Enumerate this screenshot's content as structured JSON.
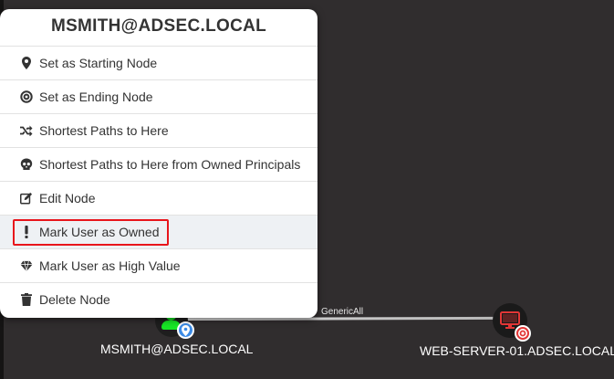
{
  "context_menu": {
    "title": "MSMITH@ADSEC.LOCAL",
    "items": [
      {
        "label": "Set as Starting Node",
        "icon": "map-marker-icon"
      },
      {
        "label": "Set as Ending Node",
        "icon": "target-icon"
      },
      {
        "label": "Shortest Paths to Here",
        "icon": "shuffle-icon"
      },
      {
        "label": "Shortest Paths to Here from Owned Principals",
        "icon": "skull-icon"
      },
      {
        "label": "Edit Node",
        "icon": "edit-icon"
      },
      {
        "label": "Mark User as Owned",
        "icon": "exclamation-icon",
        "highlighted": true
      },
      {
        "label": "Mark User as High Value",
        "icon": "gem-icon"
      },
      {
        "label": "Delete Node",
        "icon": "trash-icon"
      }
    ]
  },
  "graph": {
    "edge_label": "GenericAll",
    "source_node": {
      "label": "MSMITH@ADSEC.LOCAL",
      "type": "user",
      "color": "#17e625"
    },
    "target_node": {
      "label": "WEB-SERVER-01.ADSEC.LOCAL",
      "type": "computer",
      "color": "#e23636"
    }
  },
  "colors": {
    "background": "#302d2e",
    "highlight_outline": "#e8151b"
  }
}
